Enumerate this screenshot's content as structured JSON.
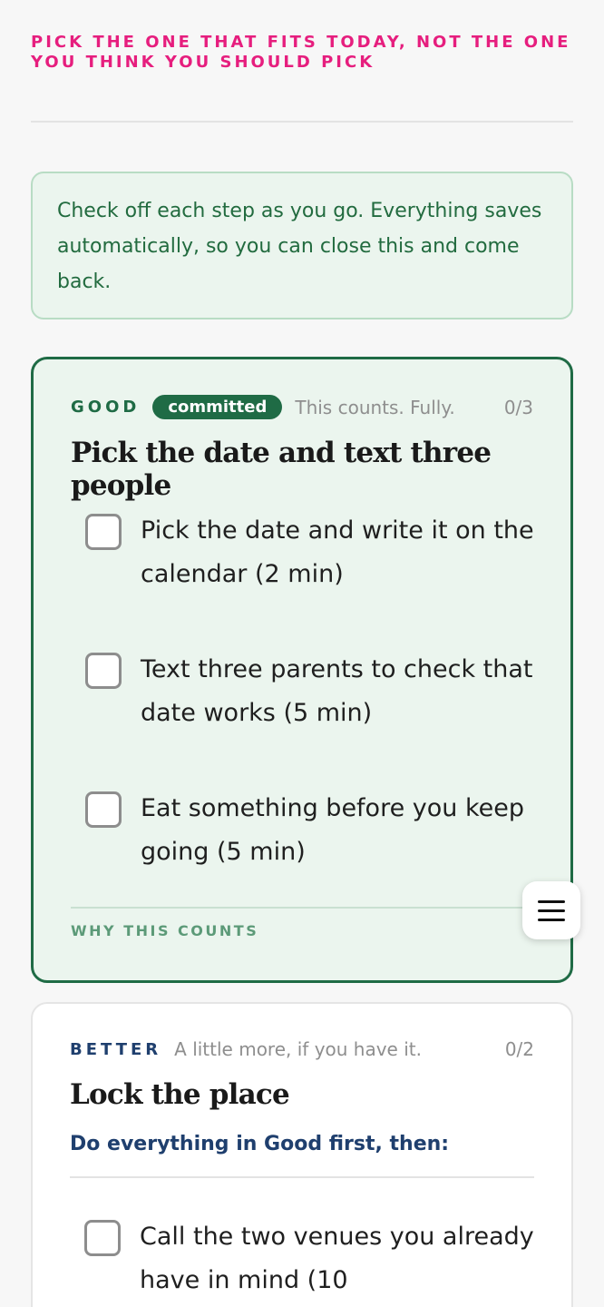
{
  "headline": "PICK THE ONE THAT FITS TODAY, NOT THE ONE YOU THINK YOU SHOULD PICK",
  "info": "Check off each step as you go. Everything saves automatically, so you can close this and come back.",
  "good": {
    "tier": "GOOD",
    "badge": "committed",
    "subtitle": "This counts. Fully.",
    "count": "0/3",
    "title": "Pick the date and text three people",
    "steps": [
      {
        "text": "Pick the date and write it on the calendar (2 min)",
        "checked": false
      },
      {
        "text": "Text three parents to check that date works (5 min)",
        "checked": false
      },
      {
        "text": "Eat something before you keep going (5 min)",
        "checked": false
      }
    ],
    "why_label": "WHY THIS COUNTS"
  },
  "better": {
    "tier": "BETTER",
    "subtitle": "A little more, if you have it.",
    "count": "0/2",
    "title": "Lock the place",
    "prereq": "Do everything in Good first, then:",
    "steps": [
      {
        "text": "Call the two venues you already have in mind (10",
        "checked": false
      }
    ]
  },
  "colors": {
    "headline": "#e61e7e",
    "good_accent": "#1f6b45",
    "good_bg": "#ebf5ee",
    "better_accent": "#1f3f6e"
  },
  "menu_icon": "hamburger-menu-icon"
}
